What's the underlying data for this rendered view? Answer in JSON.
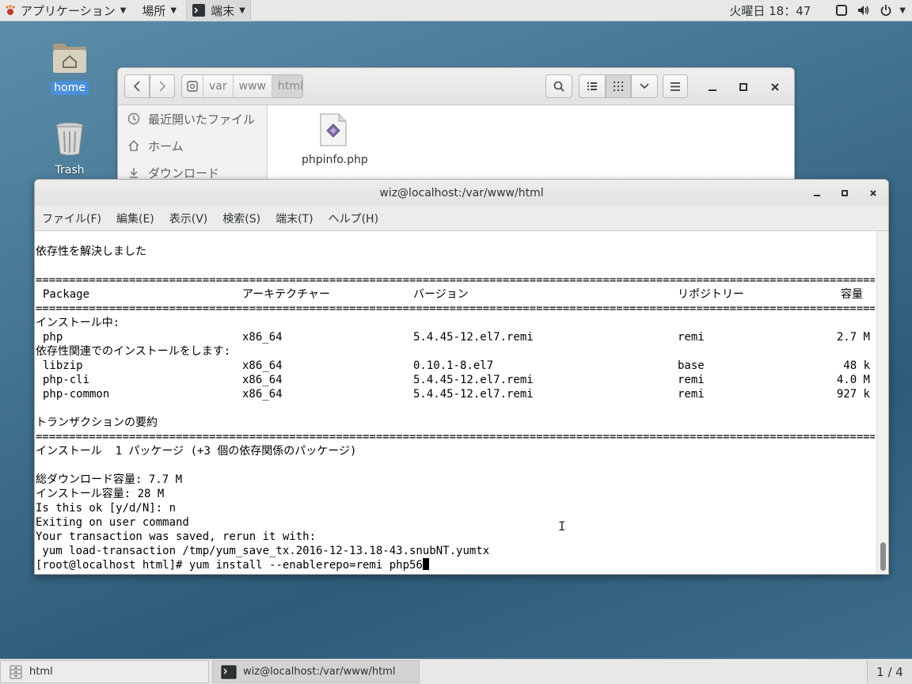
{
  "topbar": {
    "applications": "アプリケーション",
    "places": "場所",
    "app_name": "端末",
    "clock": "火曜日 18：47"
  },
  "desktop": {
    "home_label": "home",
    "trash_label": "Trash"
  },
  "file_manager": {
    "path": [
      "var",
      "www",
      "html"
    ],
    "sidebar": [
      "最近開いたファイル",
      "ホーム",
      "ダウンロード"
    ],
    "file_name": "phpinfo.php"
  },
  "terminal": {
    "title": "wiz@localhost:/var/www/html",
    "menu": [
      "ファイル(F)",
      "編集(E)",
      "表示(V)",
      "検索(S)",
      "端末(T)",
      "ヘルプ(H)"
    ],
    "resolved": "依存性を解決しました",
    "rule": "==================================================================================================================================",
    "header": {
      "package": "Package",
      "arch": "アーキテクチャー",
      "version": "バージョン",
      "repo": "リポジトリー",
      "size": "容量"
    },
    "installing_label": "インストール中:",
    "installing": [
      {
        "name": "php",
        "arch": "x86_64",
        "version": "5.4.45-12.el7.remi",
        "repo": "remi",
        "size": "2.7 M"
      }
    ],
    "deps_label": "依存性関連でのインストールをします:",
    "deps": [
      {
        "name": "libzip",
        "arch": "x86_64",
        "version": "0.10.1-8.el7",
        "repo": "base",
        "size": "48 k"
      },
      {
        "name": "php-cli",
        "arch": "x86_64",
        "version": "5.4.45-12.el7.remi",
        "repo": "remi",
        "size": "4.0 M"
      },
      {
        "name": "php-common",
        "arch": "x86_64",
        "version": "5.4.45-12.el7.remi",
        "repo": "remi",
        "size": "927 k"
      }
    ],
    "summary_label": "トランザクションの要約",
    "install_summary": "インストール  1 パッケージ (+3 個の依存関係のパッケージ)",
    "download_size": "総ダウンロード容量: 7.7 M",
    "install_size": "インストール容量: 28 M",
    "prompt_ok": "Is this ok [y/d/N]: n",
    "exiting": "Exiting on user command",
    "saved": "Your transaction was saved, rerun it with:",
    "rerun": " yum load-transaction /tmp/yum_save_tx.2016-12-13.18-43.snubNT.yumtx",
    "command_line": "[root@localhost html]# yum install --enablerepo=remi php56"
  },
  "taskbar": {
    "task1": "html",
    "task2": "wiz@localhost:/var/www/html",
    "workspace": "1 / 4"
  }
}
